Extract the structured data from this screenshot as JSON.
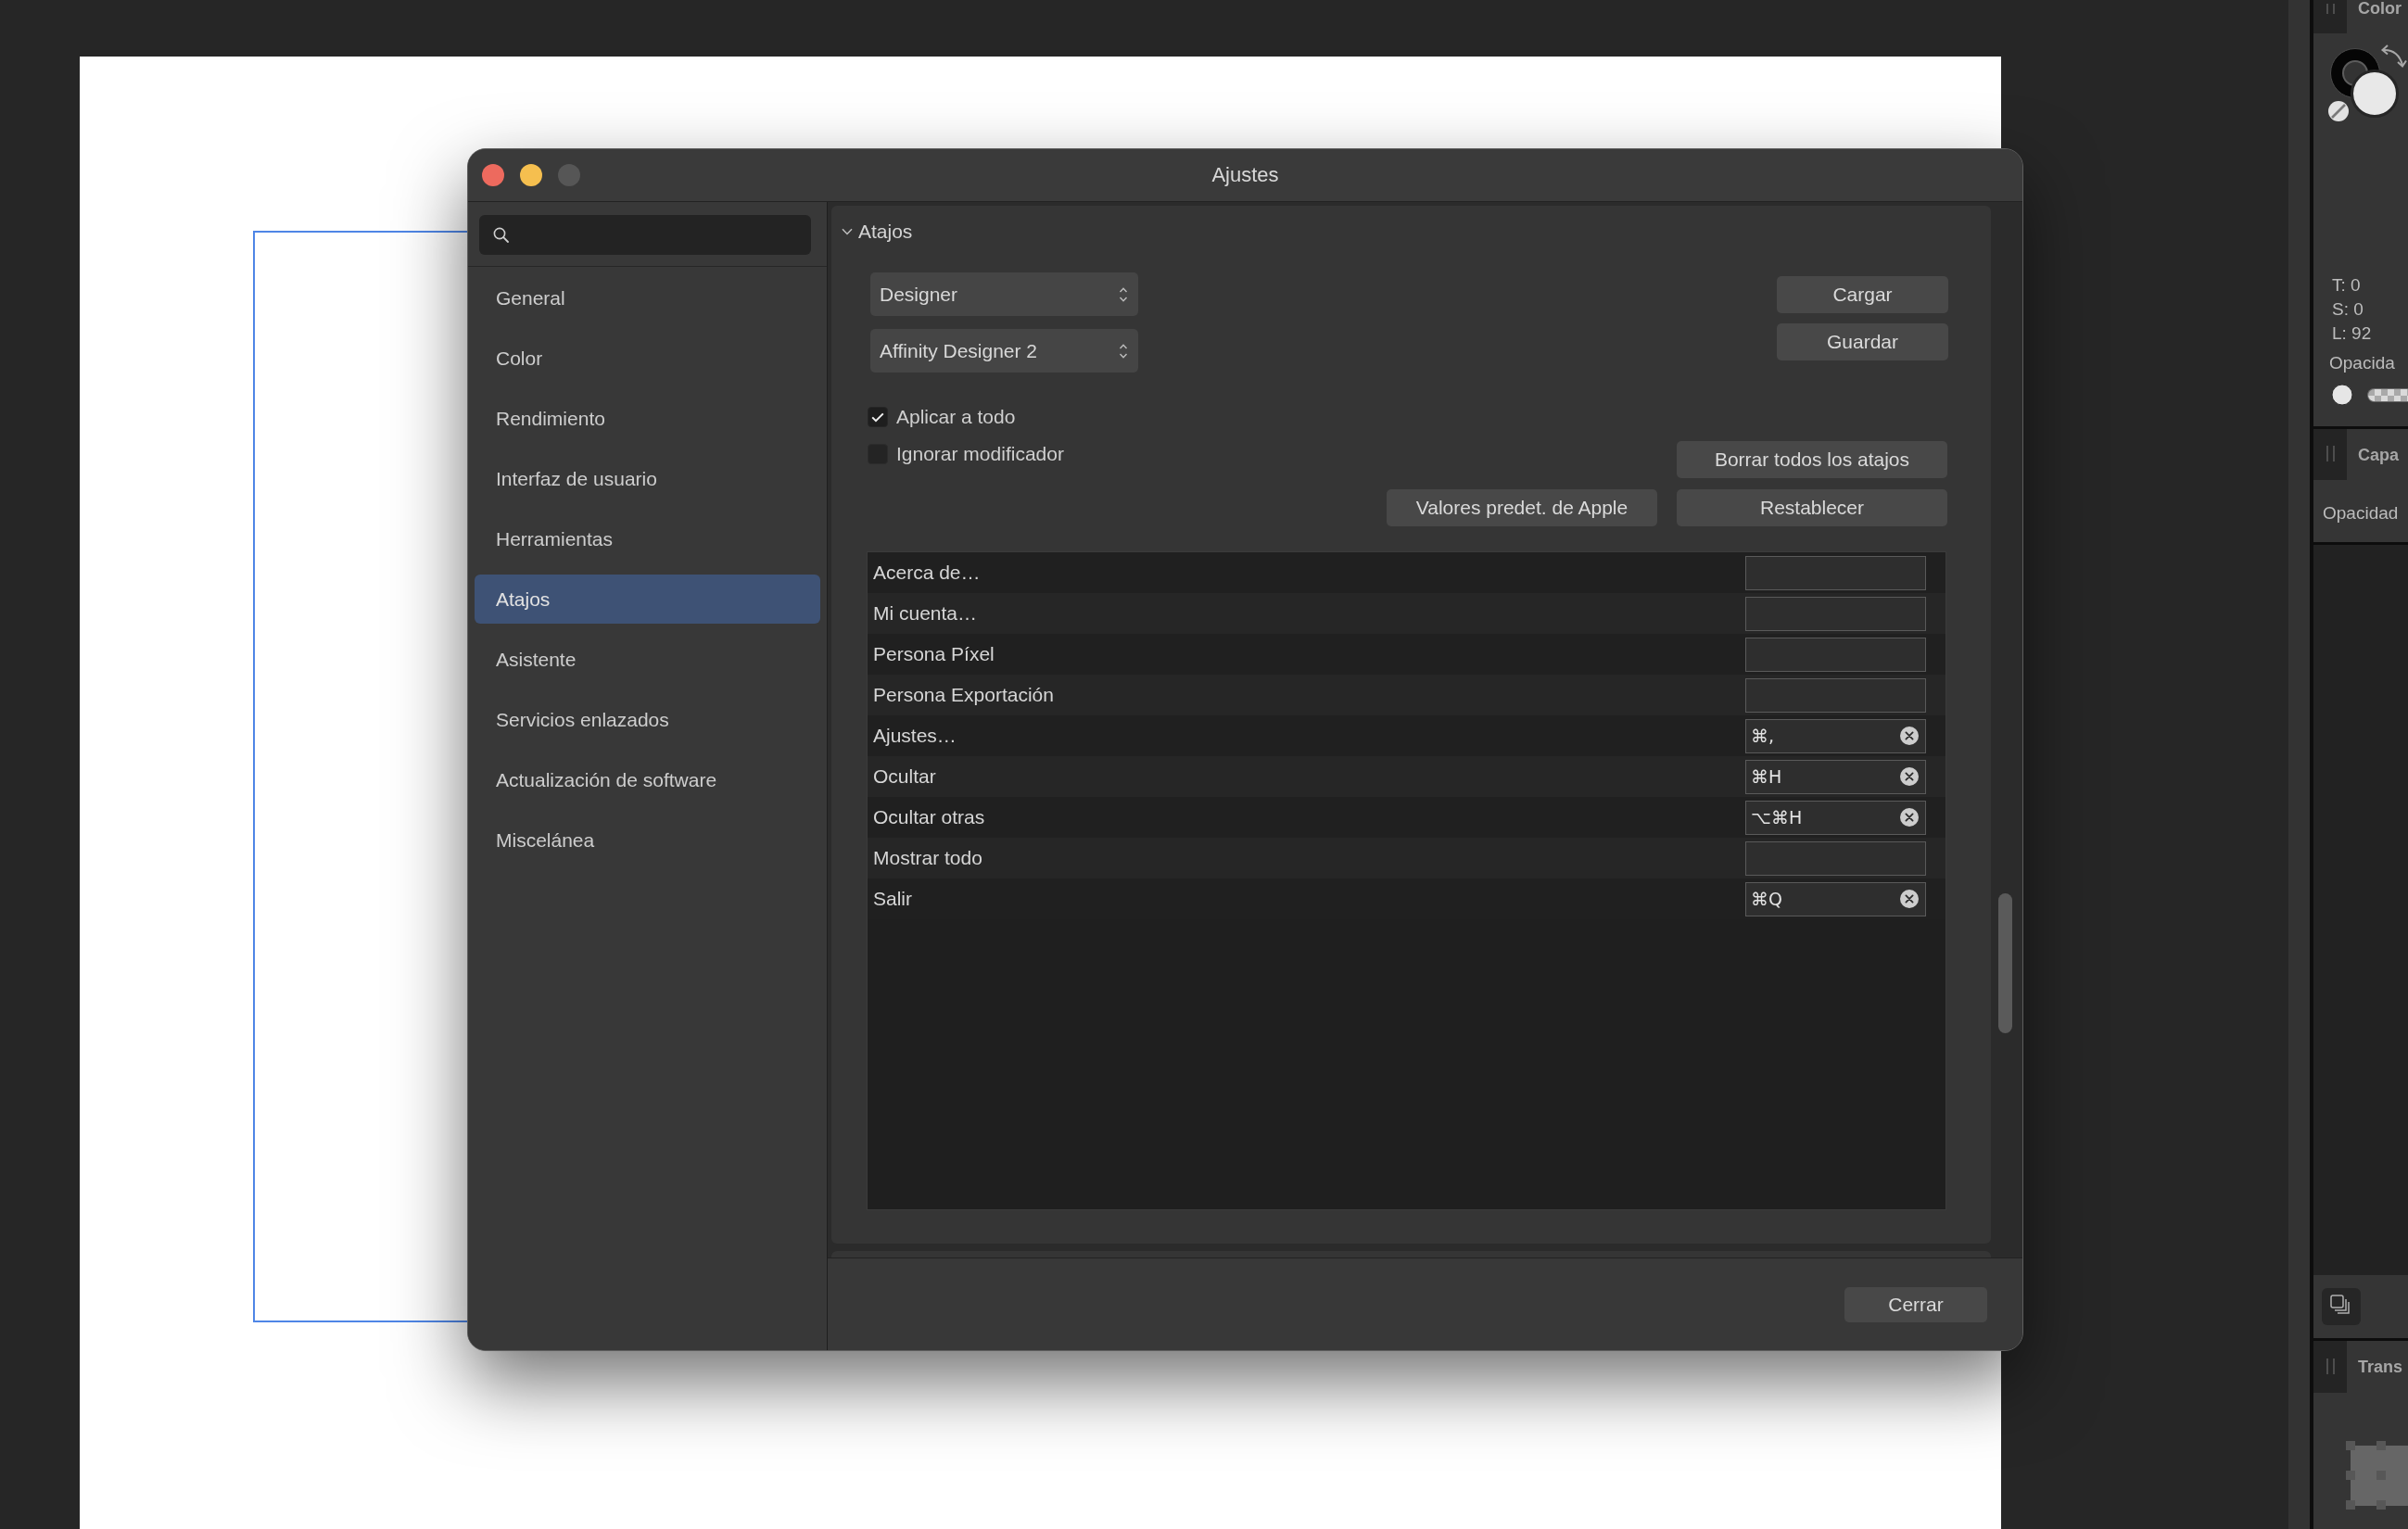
{
  "dialog": {
    "title": "Ajustes",
    "window_controls": [
      {
        "kind": "close",
        "disabled": false
      },
      {
        "kind": "minimize",
        "disabled": false
      },
      {
        "kind": "zoom",
        "disabled": true
      }
    ],
    "sidebar": {
      "items": [
        {
          "label": "General",
          "selected": false
        },
        {
          "label": "Color",
          "selected": false
        },
        {
          "label": "Rendimiento",
          "selected": false
        },
        {
          "label": "Interfaz de usuario",
          "selected": false
        },
        {
          "label": "Herramientas",
          "selected": false
        },
        {
          "label": "Atajos",
          "selected": true
        },
        {
          "label": "Asistente",
          "selected": false
        },
        {
          "label": "Servicios enlazados",
          "selected": false
        },
        {
          "label": "Actualización de software",
          "selected": false
        },
        {
          "label": "Miscelánea",
          "selected": false
        }
      ]
    },
    "section": {
      "title": "Atajos",
      "expanded": true
    },
    "popups": [
      {
        "value": "Designer"
      },
      {
        "value": "Affinity Designer 2"
      }
    ],
    "file_buttons": [
      "Cargar",
      "Guardar"
    ],
    "checkboxes": [
      {
        "label": "Aplicar a todo",
        "checked": true
      },
      {
        "label": "Ignorar modificador",
        "checked": false
      }
    ],
    "reset_buttons": [
      "Borrar todos los atajos",
      "Valores predet. de Apple",
      "Restablecer"
    ],
    "shortcuts": [
      {
        "command": "Acerca de…"
      },
      {
        "command": "Mi cuenta…"
      },
      {
        "command": "Persona Píxel"
      },
      {
        "command": "Persona Exportación"
      },
      {
        "command": "Ajustes…",
        "keys": "⌘,"
      },
      {
        "command": "Ocultar",
        "keys": "⌘H"
      },
      {
        "command": "Ocultar otras",
        "keys": "⌥⌘H"
      },
      {
        "command": "Mostrar todo"
      },
      {
        "command": "Salir",
        "keys": "⌘Q"
      }
    ],
    "footer_buttons": [
      "Cerrar"
    ]
  },
  "panels": {
    "color": {
      "title": "Color",
      "readings": [
        "T: 0",
        "S: 0",
        "L: 92"
      ],
      "opacity_label": "Opacida"
    },
    "layers": {
      "title": "Capa",
      "opacity_label": "Opacidad"
    },
    "transform": {
      "title": "Trans"
    }
  }
}
